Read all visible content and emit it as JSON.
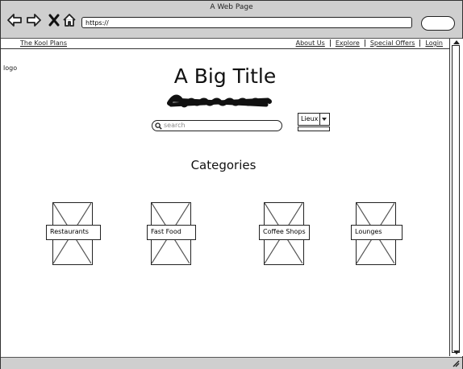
{
  "window": {
    "title": "A Web Page"
  },
  "addressbar": {
    "url": "https://"
  },
  "topnav": {
    "brand": "The Kool Plans",
    "links": [
      "About Us",
      "Explore",
      "Special Offers",
      "Login"
    ]
  },
  "header": {
    "logo": "logo",
    "title": "A Big Title"
  },
  "search": {
    "placeholder": "search"
  },
  "dropdown": {
    "selected": "Lieux"
  },
  "categories": {
    "heading": "Categories",
    "items": [
      "Restaurants",
      "Fast Food",
      "Coffee Shops",
      "Lounges"
    ]
  },
  "icons": [
    "back-arrow-icon",
    "forward-arrow-icon",
    "close-x-icon",
    "home-icon",
    "search-icon",
    "chevron-down-icon",
    "resize-grip-icon"
  ]
}
